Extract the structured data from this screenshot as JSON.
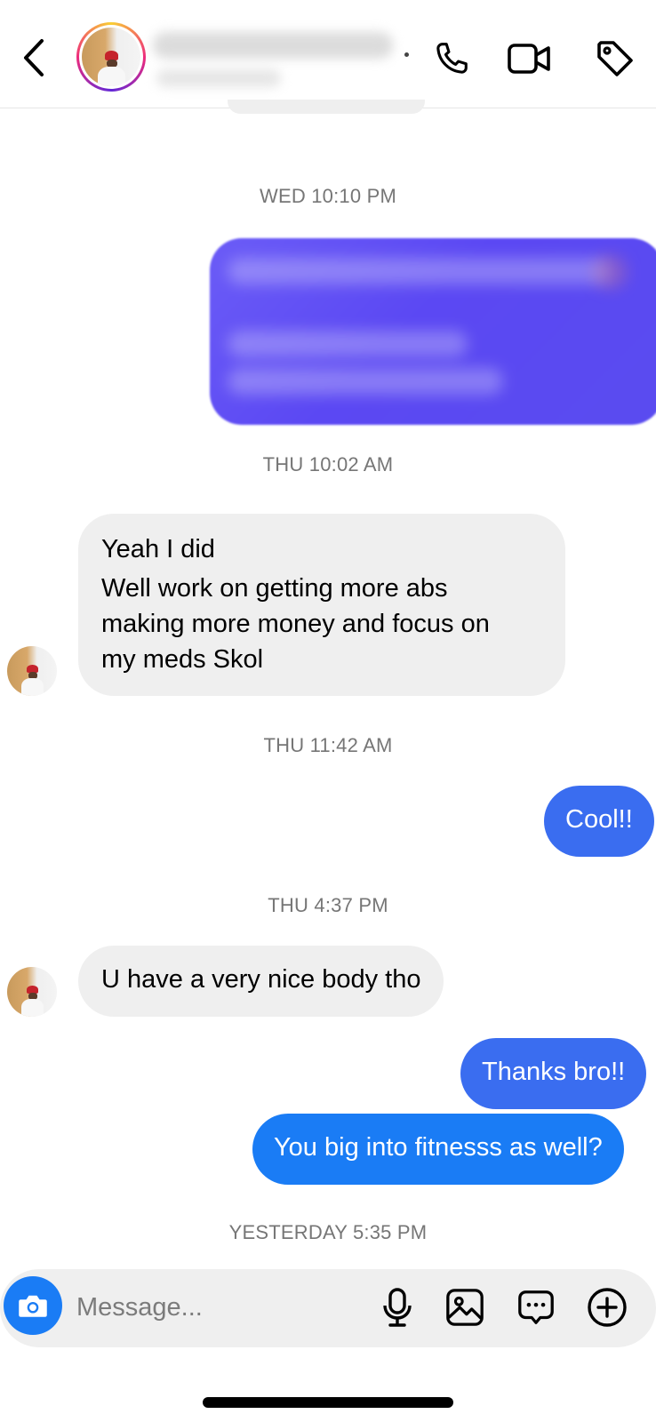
{
  "header": {
    "back_icon": "chevron-left-icon",
    "actions": [
      {
        "icon": "phone-icon"
      },
      {
        "icon": "video-camera-icon"
      },
      {
        "icon": "tag-icon"
      }
    ]
  },
  "conversation": {
    "timestamps": [
      "WED 10:10 PM",
      "THU 10:02 AM",
      "THU 11:42 AM",
      "THU 4:37 PM",
      "YESTERDAY 5:35 PM"
    ],
    "messages": [
      {
        "from": "them",
        "lines": [
          "Yeah I did",
          "Well work on getting more abs",
          "making more money and focus on",
          "my meds Skol"
        ]
      },
      {
        "from": "me",
        "text": "Cool!!"
      },
      {
        "from": "them",
        "text": "U have a very nice body tho"
      },
      {
        "from": "me",
        "text": "Thanks bro!!"
      },
      {
        "from": "me",
        "text": "You big into fitnesss as well?"
      }
    ]
  },
  "composer": {
    "placeholder": "Message...",
    "icons": [
      "camera-icon",
      "microphone-icon",
      "image-icon",
      "sticker-message-icon",
      "plus-circle-icon"
    ]
  },
  "colors": {
    "sent_bubble": "#3a6df0",
    "sent_bubble_alt": "#1a7cf5",
    "received_bubble": "#efefef",
    "timestamp": "#767676"
  }
}
